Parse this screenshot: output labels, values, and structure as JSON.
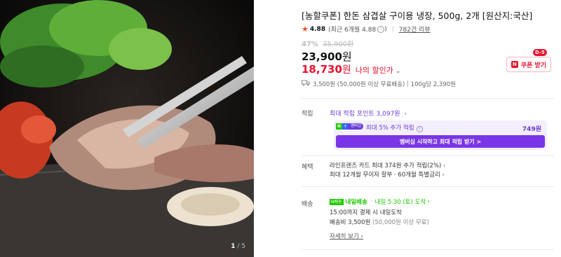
{
  "product": {
    "title": "[농할쿠폰] 한돈 삼겹살 구이용 냉장, 500g, 2개 [원산지:국산]",
    "image_counter": {
      "current": "1",
      "total": "5"
    }
  },
  "rating": {
    "score": "4.88",
    "recent": "(최근 6개월 4.88",
    "recent_close": ")",
    "review_count": "782건 리뷰"
  },
  "price": {
    "discount_pct": "47%",
    "original": "35,900원",
    "sale": "23,900",
    "sale_won": "원",
    "my_price": "18,730",
    "my_price_won": "원",
    "my_price_label": "나의 할인가"
  },
  "coupon": {
    "label": "쿠폰 받기",
    "badge": "D-5",
    "icon": "N"
  },
  "shipping_summary": {
    "fee": "3,500원",
    "condition": "(50,000원 이상 무료배송)",
    "unit_price": "100g당 2,390원"
  },
  "points": {
    "label": "적립",
    "max_link": "최대 적립 포인트 3,097원",
    "membership_badge": {
      "n": "N",
      "plus": "+",
      "text": "멤버십"
    },
    "extra": "최대 5% 추가 적립",
    "extra_amount": "749원",
    "cta": "멤버십 시작하고 최대 적립 받기 >"
  },
  "benefits": {
    "label": "혜택",
    "card": "라인프렌즈 카드 최대 374원 추가 적립(2%)",
    "installment": "최대 12개월 무이자 할부 · 60개월 특별금리"
  },
  "delivery": {
    "label": "배송",
    "tag": "N배송",
    "type": "내일배송",
    "date": "내일 5.30.(토) 도착",
    "cutoff": "15:00까지 결제 시 내일도착",
    "fee": "배송비 3,500원",
    "fee_condition": "(50,000원 이상 무료)",
    "more": "자세히 보기"
  },
  "colors": {
    "accent_red": "#e8102e",
    "purple": "#6b3bd6",
    "green": "#1ec800"
  }
}
